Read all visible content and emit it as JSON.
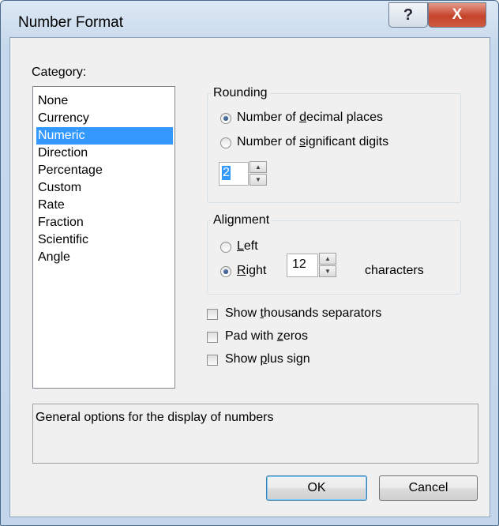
{
  "window": {
    "title": "Number Format",
    "help_glyph": "?",
    "close_glyph": "X"
  },
  "category": {
    "label": "Category:",
    "items": [
      "None",
      "Currency",
      "Numeric",
      "Direction",
      "Percentage",
      "Custom",
      "Rate",
      "Fraction",
      "Scientific",
      "Angle"
    ],
    "selected": "Numeric"
  },
  "rounding": {
    "title": "Rounding",
    "decimal_places_pre": "Number of ",
    "decimal_places_key": "d",
    "decimal_places_post": "ecimal places",
    "significant_digits_pre": "Number of ",
    "significant_digits_key": "s",
    "significant_digits_post": "ignificant digits",
    "selected_option": "decimal_places",
    "value": "2"
  },
  "alignment": {
    "title": "Alignment",
    "left_key": "L",
    "left_post": "eft",
    "right_key": "R",
    "right_post": "ight",
    "selected_option": "right",
    "width_value": "12",
    "characters_label": "characters"
  },
  "options": {
    "thousands_pre": "Show ",
    "thousands_key": "t",
    "thousands_post": "housands separators",
    "thousands_checked": false,
    "pad_pre": "Pad with ",
    "pad_key": "z",
    "pad_post": "eros",
    "pad_checked": false,
    "plus_pre": "Show ",
    "plus_key": "p",
    "plus_post": "lus sign",
    "plus_checked": false
  },
  "description": "General options for the display of numbers",
  "buttons": {
    "ok": "OK",
    "cancel": "Cancel"
  }
}
